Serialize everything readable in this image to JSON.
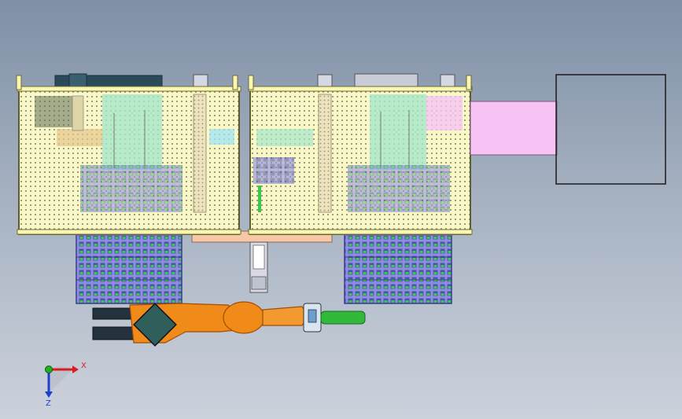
{
  "viewport": {
    "background_top": "#7f8fa6",
    "background_bottom": "#ccd2dc"
  },
  "triad": {
    "x_label": "X",
    "z_label": "Z",
    "x_color": "#d81e1e",
    "y_color": "#20b020",
    "z_color": "#1c3fd0"
  },
  "colors": {
    "frame_yellow": "#fbf7b0",
    "frame_outline": "#6b6b3a",
    "grid_dots": "#9aa08a",
    "rack_purple": "#7f82d8",
    "rack_cell": "#5b5fb6",
    "rack_green": "#33c64a",
    "robot_orange": "#f08a18",
    "robot_dark": "#a34e05",
    "gripper_green": "#32b83a",
    "mint": "#a6e6c8",
    "pink": "#f6c3f4",
    "salmon": "#f6c8a8",
    "navy": "#2b4a5a"
  },
  "icons": [
    "coordinate-triad-icon"
  ]
}
